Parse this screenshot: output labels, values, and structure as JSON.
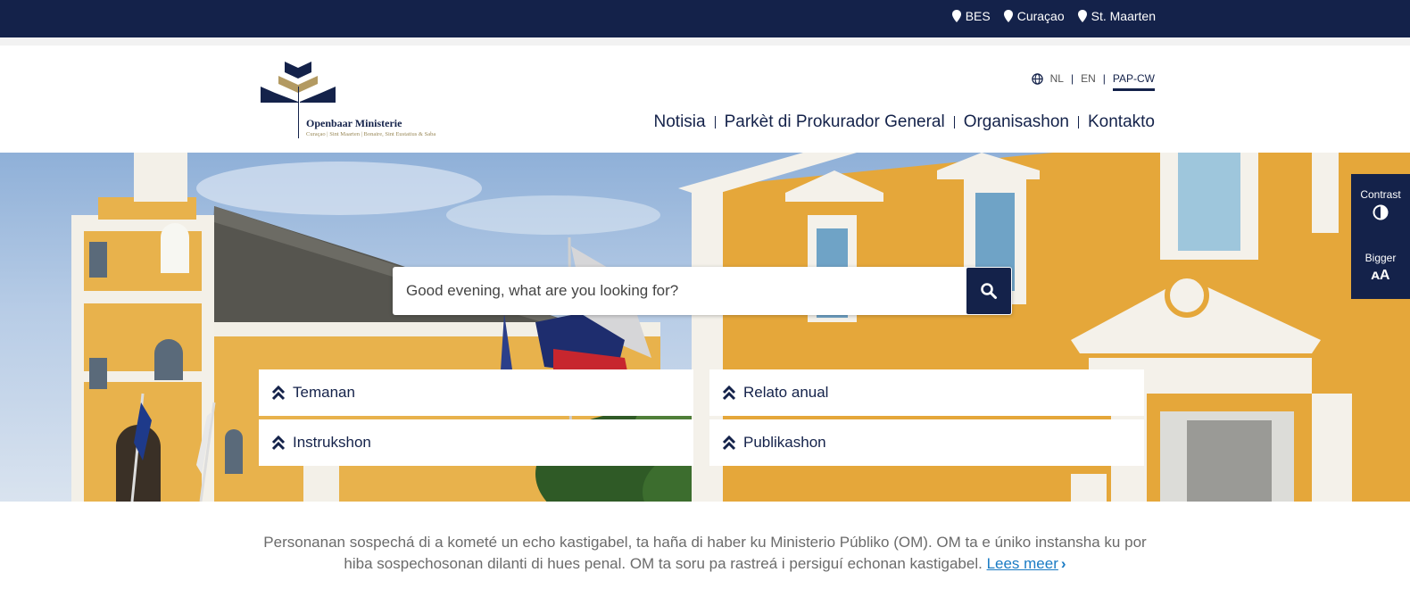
{
  "topbar": {
    "regions": [
      {
        "label": "BES",
        "icon": "map-pin-icon"
      },
      {
        "label": "Curaçao",
        "icon": "map-pin-icon"
      },
      {
        "label": "St. Maarten",
        "icon": "map-pin-icon"
      }
    ]
  },
  "header": {
    "logo": {
      "title": "Openbaar Ministerie",
      "subtitle": "Curaçao | Sint Maarten | Bonaire, Sint Eustatius & Saba"
    },
    "languages": [
      "NL",
      "EN",
      "PAP-CW"
    ],
    "active_language": "PAP-CW",
    "nav": [
      "Notisia",
      "Parkèt di Prokurador General",
      "Organisashon",
      "Kontakto"
    ]
  },
  "hero": {
    "search": {
      "placeholder": "Good evening, what are you looking for?"
    },
    "quick_links": [
      "Temanan",
      "Relato anual",
      "Instrukshon",
      "Publikashon"
    ]
  },
  "accessibility": {
    "contrast_label": "Contrast",
    "bigger_label": "Bigger",
    "bigger_glyph": "ᴀA"
  },
  "intro": {
    "text": "Personanan sospechá di a kometé un echo kastigabel, ta haña di haber ku Ministerio Públiko (OM). OM ta e úniko instansha ku por hiba sospechosonan dilanti di hues penal. OM ta soru pa rastreá i persiguí echonan kastigabel.",
    "link": "Lees meer"
  },
  "colors": {
    "navy": "#14224a",
    "gold": "#b39a62",
    "link": "#1a7bc4"
  }
}
